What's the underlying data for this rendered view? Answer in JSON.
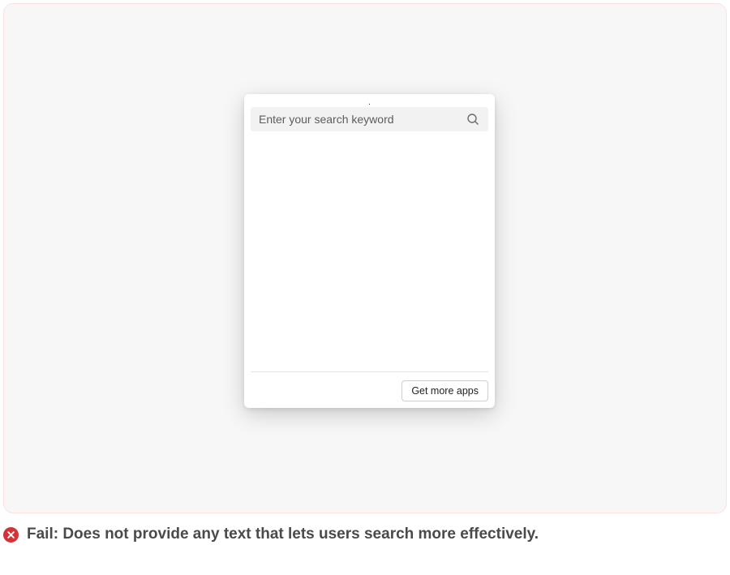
{
  "search": {
    "placeholder": "Enter your search keyword"
  },
  "footer": {
    "get_more_label": "Get more apps"
  },
  "caption": {
    "text": "Fail: Does not provide any text that lets users search more effectively."
  }
}
